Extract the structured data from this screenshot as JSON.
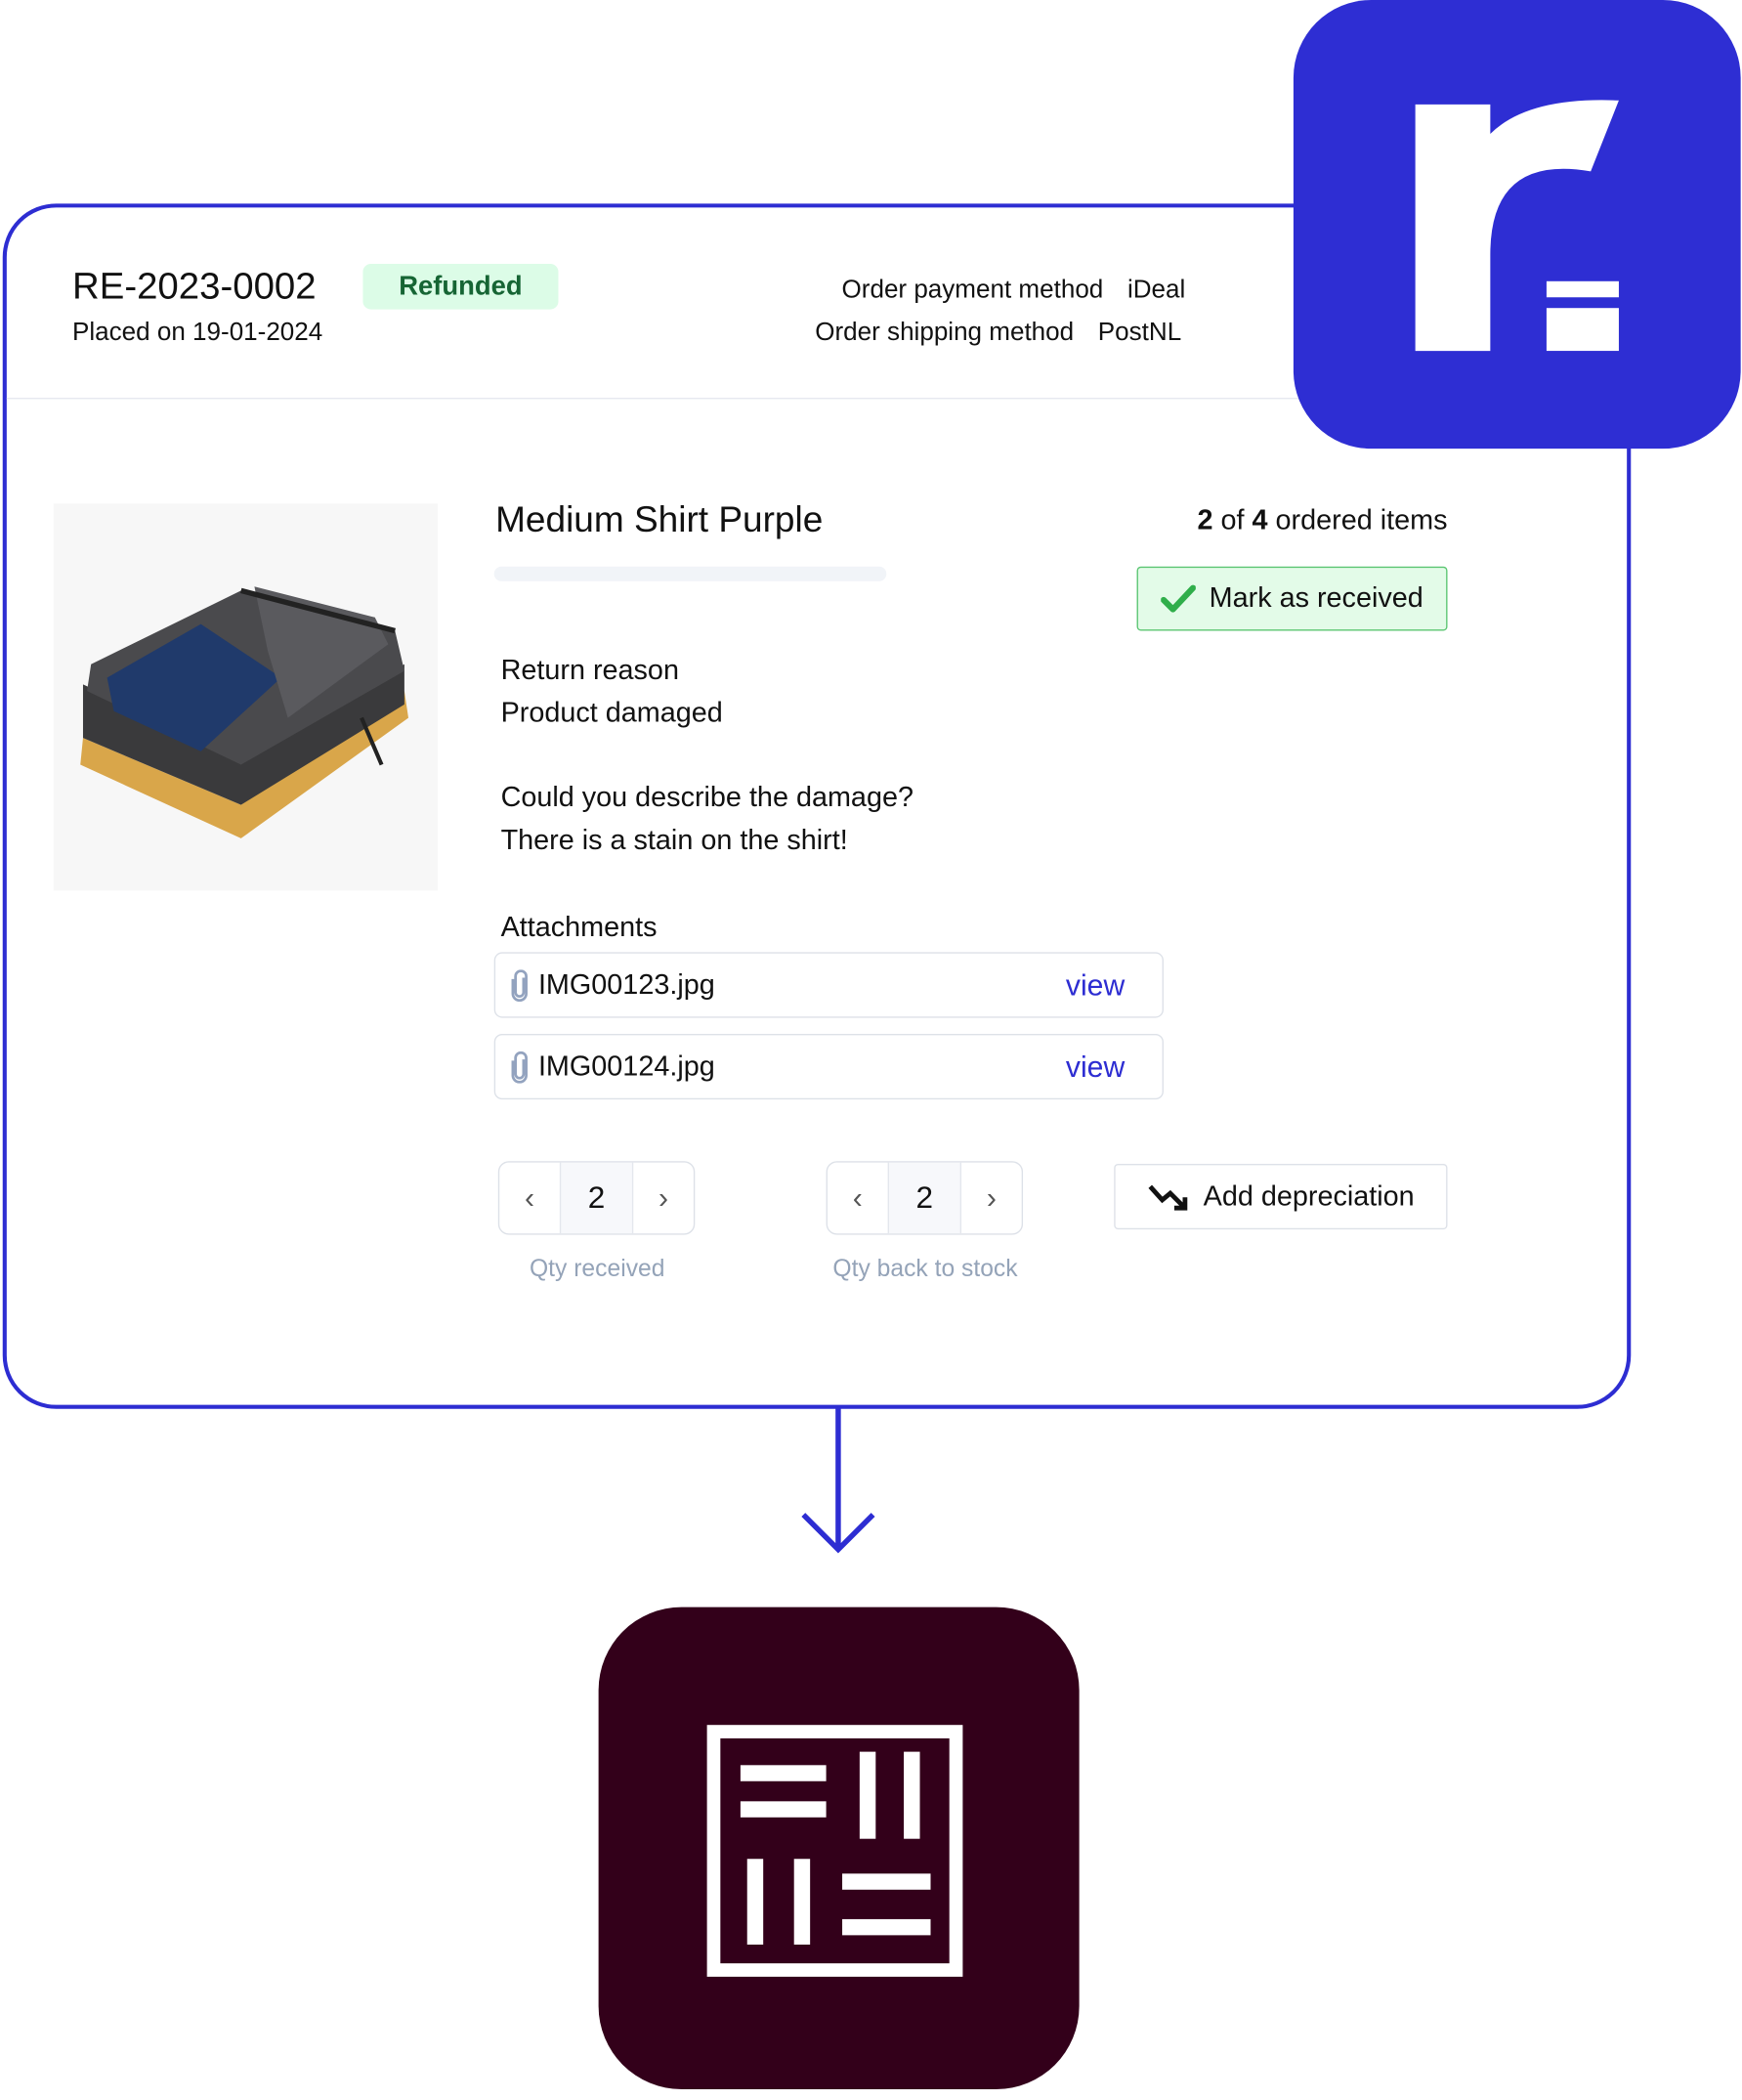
{
  "order": {
    "id": "RE-2023-0002",
    "status": "Refunded",
    "placed_on": "Placed on 19-01-2024",
    "payment_label": "Order payment method",
    "payment_value": "iDeal",
    "shipping_label": "Order shipping method",
    "shipping_value": "PostNL"
  },
  "item": {
    "title": "Medium Shirt Purple",
    "count_received": "2",
    "count_of": "of",
    "count_total": "4",
    "count_suffix": "ordered items",
    "mark_received_label": "Mark as received",
    "return_reason_label": "Return reason",
    "return_reason_value": "Product damaged",
    "question_label": "Could you describe the damage?",
    "question_answer": "There is a stain on the shirt!",
    "attachments_label": "Attachments",
    "attachments": [
      {
        "name": "IMG00123.jpg",
        "action": "view"
      },
      {
        "name": "IMG00124.jpg",
        "action": "view"
      }
    ],
    "qty_received": {
      "value": "2",
      "label": "Qty received"
    },
    "qty_back_to_stock": {
      "value": "2",
      "label": "Qty back to stock"
    },
    "add_depreciation_label": "Add depreciation"
  },
  "icons": {
    "prev": "‹",
    "next": "›",
    "check": "check-icon",
    "paperclip": "paperclip-icon",
    "trend_down": "trend-down-icon"
  },
  "colors": {
    "brand_blue": "#2e2ed3",
    "dark_logo": "#33001a",
    "success_bg": "#dcfce7",
    "success_text": "#166534"
  }
}
